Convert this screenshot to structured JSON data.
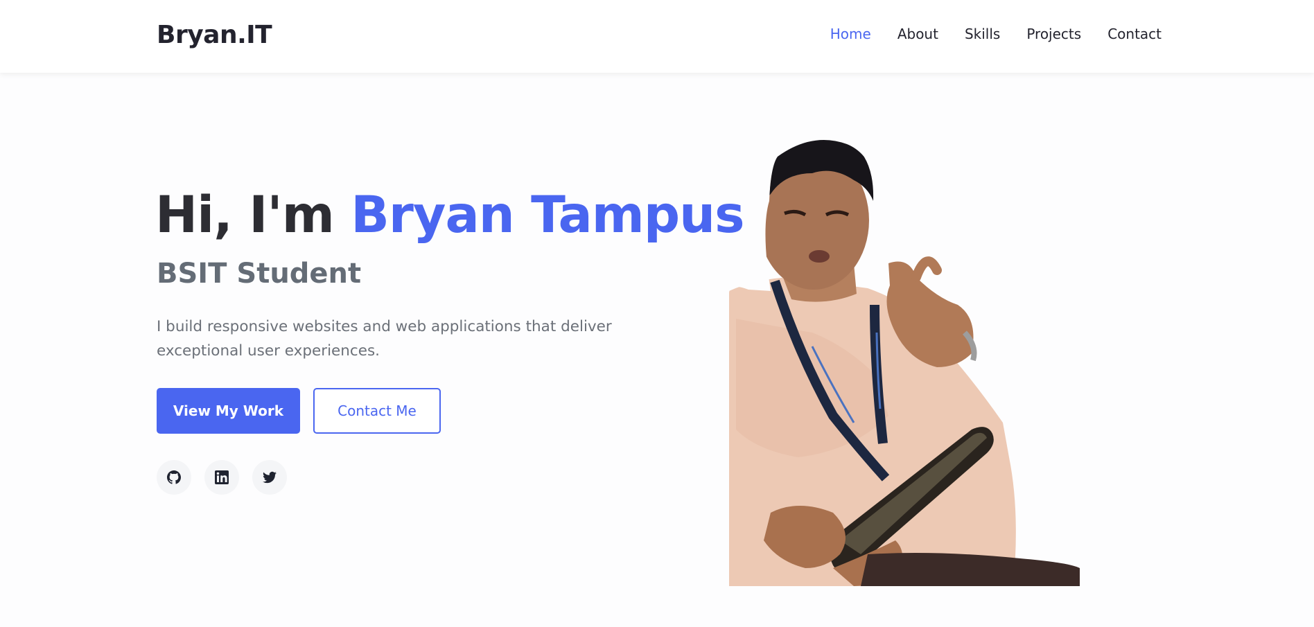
{
  "nav": {
    "logo": "Bryan.IT",
    "links": [
      {
        "label": "Home",
        "active": true
      },
      {
        "label": "About",
        "active": false
      },
      {
        "label": "Skills",
        "active": false
      },
      {
        "label": "Projects",
        "active": false
      },
      {
        "label": "Contact",
        "active": false
      }
    ]
  },
  "hero": {
    "greeting": "Hi, I'm ",
    "name": "Bryan Tampus",
    "subtitle": "BSIT Student",
    "description": "I build responsive websites and web applications that deliver exceptional user experiences.",
    "primary_button": "View My Work",
    "secondary_button": "Contact Me"
  },
  "socials": [
    {
      "icon": "github-icon"
    },
    {
      "icon": "linkedin-icon"
    },
    {
      "icon": "twitter-icon"
    }
  ],
  "colors": {
    "accent": "#4a66f0",
    "heading": "#2d2d33",
    "subtitle": "#646c76",
    "body_text": "#6b7078"
  }
}
